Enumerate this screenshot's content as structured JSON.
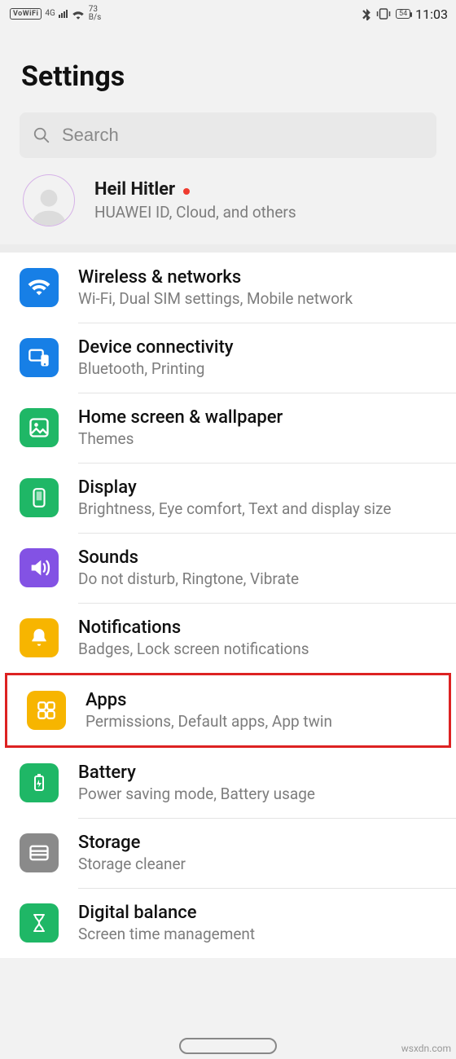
{
  "status": {
    "vowifi": "VoWiFi",
    "net": "4G",
    "speed_top": "73",
    "speed_bot": "B/s",
    "battery": "54",
    "time": "11:03"
  },
  "page_title": "Settings",
  "search": {
    "placeholder": "Search"
  },
  "account": {
    "name": "Heil Hitler",
    "sub": "HUAWEI ID, Cloud, and others"
  },
  "colors": {
    "blue": "#177fe6",
    "green": "#1fb766",
    "purple": "#8352e4",
    "amber": "#f7b500",
    "grey": "#8a8a8a"
  },
  "items": [
    {
      "icon": "wifi",
      "color": "blue",
      "title": "Wireless & networks",
      "sub": "Wi-Fi, Dual SIM settings, Mobile network"
    },
    {
      "icon": "devices",
      "color": "blue",
      "title": "Device connectivity",
      "sub": "Bluetooth, Printing"
    },
    {
      "icon": "wallpaper",
      "color": "green",
      "title": "Home screen & wallpaper",
      "sub": "Themes"
    },
    {
      "icon": "display",
      "color": "green",
      "title": "Display",
      "sub": "Brightness, Eye comfort, Text and display size"
    },
    {
      "icon": "sound",
      "color": "purple",
      "title": "Sounds",
      "sub": "Do not disturb, Ringtone, Vibrate"
    },
    {
      "icon": "bell",
      "color": "amber",
      "title": "Notifications",
      "sub": "Badges, Lock screen notifications"
    },
    {
      "icon": "apps",
      "color": "amber",
      "title": "Apps",
      "sub": "Permissions, Default apps, App twin",
      "highlight": true
    },
    {
      "icon": "battery",
      "color": "green",
      "title": "Battery",
      "sub": "Power saving mode, Battery usage"
    },
    {
      "icon": "storage",
      "color": "grey",
      "title": "Storage",
      "sub": "Storage cleaner"
    },
    {
      "icon": "hourglass",
      "color": "green",
      "title": "Digital balance",
      "sub": "Screen time management"
    }
  ],
  "watermark": "wsxdn.com"
}
